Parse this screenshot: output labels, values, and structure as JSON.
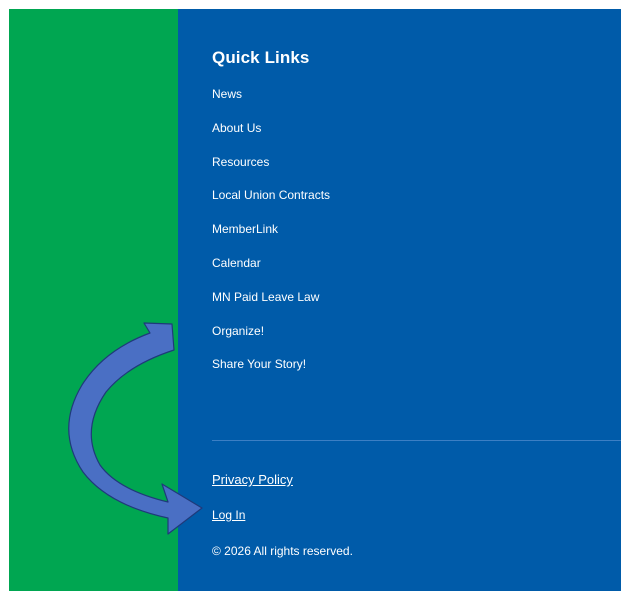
{
  "footer": {
    "quick_links_title": "Quick Links",
    "quick_links": [
      {
        "label": "News"
      },
      {
        "label": "About Us"
      },
      {
        "label": "Resources"
      },
      {
        "label": "Local Union Contracts"
      },
      {
        "label": "MemberLink"
      },
      {
        "label": "Calendar"
      },
      {
        "label": "MN Paid Leave Law"
      },
      {
        "label": "Organize!"
      },
      {
        "label": "Share Your Story!"
      }
    ],
    "privacy_policy_label": "Privacy Policy",
    "login_label": "Log In",
    "copyright": "© 2026 All rights reserved."
  },
  "colors": {
    "green_panel": "#00a651",
    "blue_panel": "#005ba9",
    "arrow_fill": "#4a6fc4",
    "arrow_stroke": "#1f3a7a"
  },
  "annotation": {
    "icon": "curved-arrow-icon",
    "points_to": "Log In"
  }
}
